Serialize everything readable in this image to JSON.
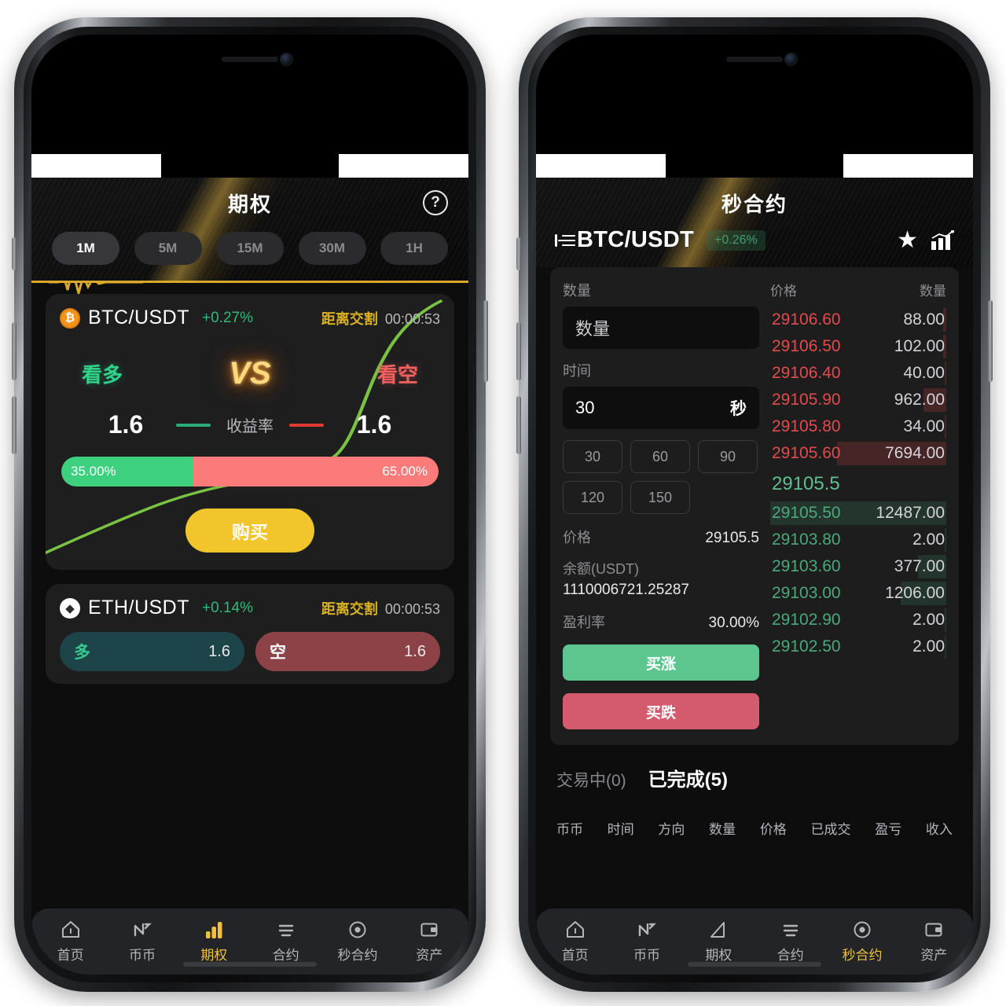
{
  "phone_left": {
    "header": {
      "title": "期权",
      "help_icon": "help-circle-icon"
    },
    "intervals": [
      {
        "label": "1M",
        "active": true
      },
      {
        "label": "5M",
        "active": false
      },
      {
        "label": "15M",
        "active": false
      },
      {
        "label": "30M",
        "active": false
      },
      {
        "label": "1H",
        "active": false
      }
    ],
    "btc_card": {
      "coin_symbol": "₿",
      "pair": "BTC/USDT",
      "change": "+0.27%",
      "settle_label": "距离交割",
      "settle_time": "00:00:53",
      "long_label": "看多",
      "vs_label": "VS",
      "short_label": "看空",
      "long_rate": "1.6",
      "rate_label": "收益率",
      "short_rate": "1.6",
      "long_pct_text": "35.00%",
      "short_pct_text": "65.00%",
      "long_pct": 35,
      "short_pct": 65,
      "buy_label": "购买"
    },
    "eth_card": {
      "coin_symbol": "◆",
      "pair": "ETH/USDT",
      "change": "+0.14%",
      "settle_label": "距离交割",
      "settle_time": "00:00:53",
      "long_tag": "多",
      "long_val": "1.6",
      "short_tag": "空",
      "short_val": "1.6"
    },
    "tabbar": [
      {
        "label": "首页",
        "icon": "home-icon",
        "active": false
      },
      {
        "label": "币币",
        "icon": "swap-icon",
        "active": false
      },
      {
        "label": "期权",
        "icon": "bars-icon",
        "active": true
      },
      {
        "label": "合约",
        "icon": "lines-icon",
        "active": false
      },
      {
        "label": "秒合约",
        "icon": "target-icon",
        "active": false
      },
      {
        "label": "资产",
        "icon": "wallet-icon",
        "active": false
      }
    ]
  },
  "phone_right": {
    "header": {
      "title": "秒合约"
    },
    "sub_header": {
      "collapse_icon": "collapse-left-icon",
      "pair": "BTC/USDT",
      "change": "+0.26%",
      "star_icon": "star-icon",
      "chart_icon": "bar-chart-trend-icon"
    },
    "form": {
      "amount_label": "数量",
      "amount_placeholder": "数量",
      "amount_value": "",
      "time_label": "时间",
      "time_value": "30",
      "time_unit": "秒",
      "quick_times": [
        "30",
        "60",
        "90",
        "120",
        "150"
      ],
      "price_label": "价格",
      "price_value": "29105.5",
      "balance_label": "余额(USDT)",
      "balance_value": "1110006721.25287",
      "profit_label": "盈利率",
      "profit_value": "30.00%",
      "buy_up": "买涨",
      "buy_down": "买跌"
    },
    "orderbook": {
      "col_price": "价格",
      "col_qty": "数量",
      "mid_price": "29105.5",
      "asks": [
        {
          "price": "29106.60",
          "qty": "88.00",
          "depth": 2
        },
        {
          "price": "29106.50",
          "qty": "102.00",
          "depth": 2
        },
        {
          "price": "29106.40",
          "qty": "40.00",
          "depth": 1
        },
        {
          "price": "29105.90",
          "qty": "962.00",
          "depth": 13
        },
        {
          "price": "29105.80",
          "qty": "34.00",
          "depth": 1
        },
        {
          "price": "29105.60",
          "qty": "7694.00",
          "depth": 62
        }
      ],
      "bids": [
        {
          "price": "29105.50",
          "qty": "12487.00",
          "depth": 100
        },
        {
          "price": "29103.80",
          "qty": "2.00",
          "depth": 1
        },
        {
          "price": "29103.60",
          "qty": "377.00",
          "depth": 16
        },
        {
          "price": "29103.00",
          "qty": "1206.00",
          "depth": 26
        },
        {
          "price": "29102.90",
          "qty": "2.00",
          "depth": 1
        },
        {
          "price": "29102.50",
          "qty": "2.00",
          "depth": 1
        }
      ]
    },
    "orders": {
      "tabs": [
        {
          "label": "交易中(0)",
          "active": false
        },
        {
          "label": "已完成(5)",
          "active": true
        }
      ],
      "columns": [
        "币币",
        "时间",
        "方向",
        "数量",
        "价格",
        "已成交",
        "盈亏",
        "收入"
      ]
    },
    "tabbar": [
      {
        "label": "首页",
        "icon": "home-icon",
        "active": false
      },
      {
        "label": "币币",
        "icon": "swap-icon",
        "active": false
      },
      {
        "label": "期权",
        "icon": "triangle-icon",
        "active": false
      },
      {
        "label": "合约",
        "icon": "lines-icon",
        "active": false
      },
      {
        "label": "秒合约",
        "icon": "target-icon",
        "active": true
      },
      {
        "label": "资产",
        "icon": "wallet-icon",
        "active": false
      }
    ]
  }
}
